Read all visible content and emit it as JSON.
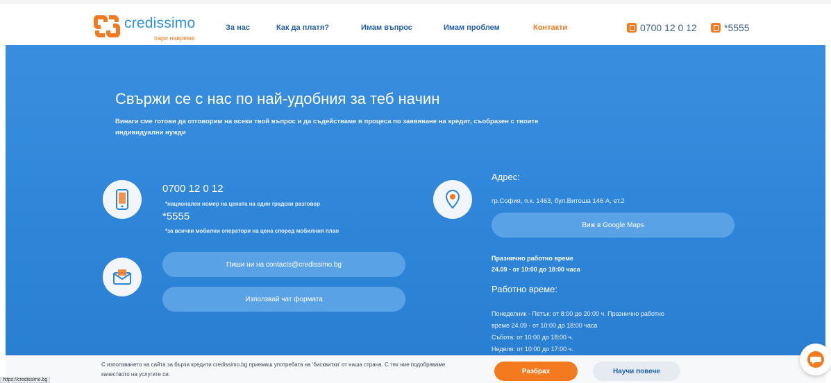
{
  "header": {
    "logo": {
      "word": "credissimo",
      "tagline": "пари навреме"
    },
    "nav": [
      {
        "label": "За нас",
        "active": false
      },
      {
        "label": "Как да платя?",
        "active": false
      },
      {
        "label": "Имам въпрос",
        "active": false
      },
      {
        "label": "Имам проблем",
        "active": false
      },
      {
        "label": "Контакти",
        "active": true
      }
    ],
    "phone_main": "0700 12 0 12",
    "phone_short": "*5555"
  },
  "hero": {
    "title": "Свържи се с нас по най-удобния за теб начин",
    "subtitle": "Винаги сме готови да отговорим на всеки твой въпрос и да съдействаме в процеса по заявяване на кредит, съобразен с твоите индивидуални нужди",
    "phone_number": "0700 12 0 12",
    "phone_note": "*национален номер на цената на един градски разговор",
    "short_number": "*5555",
    "short_note": "*за всички мобилни оператори на цена според мобилния план",
    "email_button": "Пиши ни на contacts@credissimo.bg",
    "chat_button": "Използвай чат формата",
    "address_title": "Адрес:",
    "address": "гр.София, п.к. 1463, бул.Витоша 146 А, ет.2",
    "maps_button": "Виж в Google Maps",
    "holiday_title": "Празнично работно време",
    "holiday_line": "24.09 - от 10:00 до 18:00 часа",
    "hours_title": "Работно време:",
    "hours_lines": [
      "Понеделник - Петък: от 8:00 до 20:00 ч. Празнично работно",
      "време 24.09 - от 10:00 до 18:00 часа",
      "Събота: от 10:00 до 18:00 ч.",
      "Неделя: от 10:00 до 17:00 ч."
    ]
  },
  "cookie": {
    "text": "С използването на сайта за бързи кредити credissimo.bg приемаш употребата на 'бисквитки' от наша страна. С тях ние подобряваме качеството на услугите си.",
    "accept": "Разбрах",
    "more": "Научи повече"
  },
  "status_url": "https://credissimo.bg",
  "colors": {
    "brand_blue": "#2e8fe3",
    "brand_orange": "#f37a1f",
    "nav_blue": "#1e5fa8"
  }
}
